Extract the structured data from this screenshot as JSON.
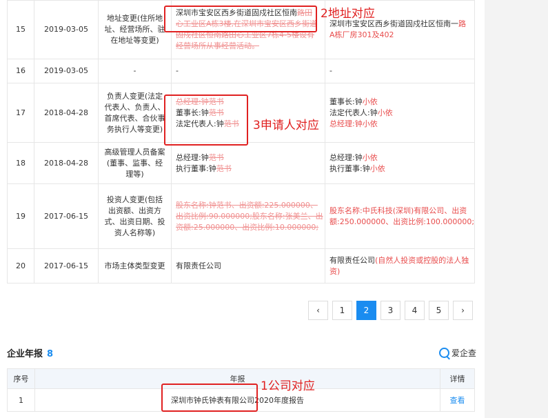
{
  "change_records": [
    {
      "no": "15",
      "date": "2019-03-05",
      "item_lines": [
        "地址变更(住所地",
        "址、经营场所、驻",
        "在地址等变更)"
      ],
      "before": [
        [
          {
            "t": "深圳市宝安区西乡街道固戍社区恒南",
            "s": "plain"
          },
          {
            "t": "路田",
            "s": "del"
          }
        ],
        [
          {
            "t": "心工业区A栋3楼,在深圳市宝安区西乡街道",
            "s": "del"
          }
        ],
        [
          {
            "t": "固戍社区恒南路田心工业区7栋4-5楼设有",
            "s": "del"
          }
        ],
        [
          {
            "t": "经营场所从事经营活动。",
            "s": "del"
          }
        ]
      ],
      "after": [
        [
          {
            "t": "深圳市宝安区西乡街道固戍社区恒南一",
            "s": "plain"
          },
          {
            "t": "路",
            "s": "hl"
          }
        ],
        [
          {
            "t": "A栋厂房301及402",
            "s": "hl"
          }
        ]
      ]
    },
    {
      "no": "16",
      "date": "2019-03-05",
      "item_lines": [
        "-"
      ],
      "before": [
        [
          {
            "t": "-",
            "s": "plain"
          }
        ]
      ],
      "after": [
        [
          {
            "t": "-",
            "s": "plain"
          }
        ]
      ]
    },
    {
      "no": "17",
      "date": "2018-04-28",
      "item_lines": [
        "负责人变更(法定",
        "代表人、负责人、",
        "首席代表、合伙事",
        "务执行人等变更)"
      ],
      "before": [
        [
          {
            "t": "总经理:钟范书",
            "s": "del"
          }
        ],
        [
          {
            "t": "董事长:钟",
            "s": "plain"
          },
          {
            "t": "范书",
            "s": "del"
          }
        ],
        [
          {
            "t": "法定代表人:钟",
            "s": "plain"
          },
          {
            "t": "范书",
            "s": "del"
          }
        ]
      ],
      "after": [
        [
          {
            "t": "董事长:钟",
            "s": "plain"
          },
          {
            "t": "小依",
            "s": "hl"
          }
        ],
        [
          {
            "t": "法定代表人:钟",
            "s": "plain"
          },
          {
            "t": "小依",
            "s": "hl"
          }
        ],
        [
          {
            "t": "总经理:钟小依",
            "s": "hl"
          }
        ]
      ]
    },
    {
      "no": "18",
      "date": "2018-04-28",
      "item_lines": [
        "高级管理人员备案",
        "(董事、监事、经",
        "理等)"
      ],
      "before": [
        [
          {
            "t": "总经理:钟",
            "s": "plain"
          },
          {
            "t": "范书",
            "s": "del"
          }
        ],
        [
          {
            "t": "执行董事:钟",
            "s": "plain"
          },
          {
            "t": "范书",
            "s": "del"
          }
        ]
      ],
      "after": [
        [
          {
            "t": "总经理:钟",
            "s": "plain"
          },
          {
            "t": "小依",
            "s": "hl"
          }
        ],
        [
          {
            "t": "执行董事:钟",
            "s": "plain"
          },
          {
            "t": "小依",
            "s": "hl"
          }
        ]
      ]
    },
    {
      "no": "19",
      "date": "2017-06-15",
      "item_lines": [
        "投资人变更(包括",
        "出资额、出资方",
        "式、出资日期、投",
        "资人名称等)"
      ],
      "before": [
        [
          {
            "t": "股东名称:钟范书、出资额:225.000000、",
            "s": "del"
          }
        ],
        [
          {
            "t": "出资比例:90.000000;股东名称:张美兰、出",
            "s": "del"
          }
        ],
        [
          {
            "t": "资额:25.000000、出资比例:10.000000;",
            "s": "del"
          }
        ]
      ],
      "after": [
        [
          {
            "t": "股东名称:中氏科技(深圳)有限公司、出资",
            "s": "hl"
          }
        ],
        [
          {
            "t": "额:250.000000、出资比例:100.000000;",
            "s": "hl"
          }
        ]
      ]
    },
    {
      "no": "20",
      "date": "2017-06-15",
      "item_lines": [
        "市场主体类型变更"
      ],
      "before": [
        [
          {
            "t": "有限责任公司",
            "s": "plain"
          }
        ]
      ],
      "after": [
        [
          {
            "t": "有限责任公司",
            "s": "plain"
          },
          {
            "t": "(自然人投资或控股的法人独",
            "s": "hl"
          }
        ],
        [
          {
            "t": "资)",
            "s": "hl"
          }
        ]
      ]
    }
  ],
  "pagination": {
    "prev": "‹",
    "pages": [
      "1",
      "2",
      "3",
      "4",
      "5"
    ],
    "current": "2",
    "next": "›"
  },
  "annual_reports": {
    "title": "企业年报",
    "count": "8",
    "logo_text": "爱企查",
    "columns": {
      "no": "序号",
      "report": "年报",
      "detail": "详情"
    },
    "rows": [
      {
        "no": "1",
        "report": "深圳市钟氏钟表有限公司2020年度报告",
        "detail": "查看"
      }
    ]
  },
  "annotations": [
    "2地址对应",
    "3申请人对应",
    "1公司对应"
  ],
  "colors": {
    "accent": "#1a8cf0",
    "markup": "#e02020",
    "deleted": "#f09090",
    "added": "#e84c4c"
  }
}
